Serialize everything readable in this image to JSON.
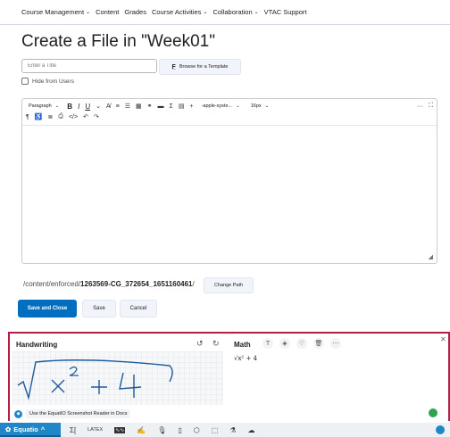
{
  "nav": {
    "items": [
      {
        "label": "Course Management",
        "dropdown": true
      },
      {
        "label": "Content",
        "dropdown": false
      },
      {
        "label": "Grades",
        "dropdown": false
      },
      {
        "label": "Course Activities",
        "dropdown": true
      },
      {
        "label": "Collaboration",
        "dropdown": true
      },
      {
        "label": "VTAC Support",
        "dropdown": false
      }
    ]
  },
  "page": {
    "title": "Create a File in \"Week01\""
  },
  "form": {
    "title_placeholder": "Enter a Title",
    "browse_label": "Browse for a Template",
    "hide_label": "Hide from Users"
  },
  "editor": {
    "format_select": "Paragraph",
    "font_select": "-apple-syste...",
    "size_select": "16px",
    "more": "···"
  },
  "path": {
    "prefix": "/content/enforced/",
    "bold": "1263569-CG_372654_1651160461",
    "suffix": "/",
    "change_label": "Change Path"
  },
  "actions": {
    "save_close": "Save and Close",
    "save": "Save",
    "cancel": "Cancel"
  },
  "equatio": {
    "handwriting_title": "Handwriting",
    "math_title": "Math",
    "math_expression": "√x² + 4",
    "handwriting_text": "√x² + 4",
    "hint": "Use the EquatIO Screenshot Reader in Docs",
    "brand": "Equatio"
  },
  "colors": {
    "primary": "#006fbf",
    "panel_border": "#b11f45",
    "equatio_blue": "#1f86c7"
  }
}
